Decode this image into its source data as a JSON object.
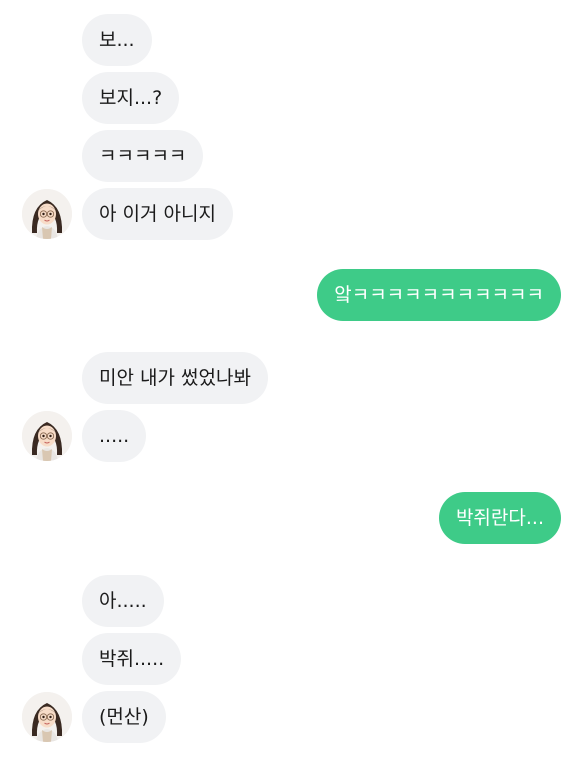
{
  "messages": [
    {
      "text": "보...",
      "from": "them"
    },
    {
      "text": "보지...?",
      "from": "them"
    },
    {
      "text": "ㅋㅋㅋㅋㅋ",
      "from": "them"
    },
    {
      "text": "아 이거 아니지",
      "from": "them"
    },
    {
      "text": "앜ㅋㅋㅋㅋㅋㅋㅋㅋㅋㅋㅋ",
      "from": "me"
    },
    {
      "text": "미안 내가 썼었나봐",
      "from": "them"
    },
    {
      "text": ".....",
      "from": "them"
    },
    {
      "text": "박쥐란다...",
      "from": "me"
    },
    {
      "text": "아.....",
      "from": "them"
    },
    {
      "text": "박쥐.....",
      "from": "them"
    },
    {
      "text": "(먼산)",
      "from": "them"
    }
  ],
  "avatar_icon": "profile-avatar-girl",
  "colors": {
    "incoming_bubble": "#f1f2f4",
    "outgoing_bubble": "#3ecb88",
    "outgoing_text": "#ffffff"
  }
}
